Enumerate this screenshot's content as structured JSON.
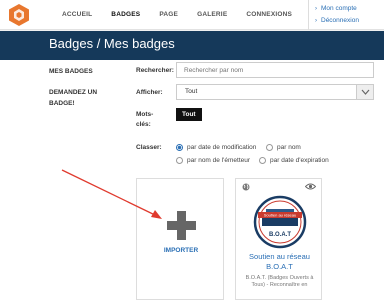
{
  "nav": {
    "items": [
      "ACCUEIL",
      "BADGES",
      "PAGE",
      "GALERIE",
      "CONNEXIONS"
    ],
    "active_index": 1
  },
  "user_menu": {
    "profile": "Mon compte",
    "logout": "Déconnexion"
  },
  "header": {
    "title": "Badges / Mes badges"
  },
  "sidebar": {
    "items": [
      "MES BADGES",
      "DEMANDEZ UN BADGE!"
    ]
  },
  "filters": {
    "search_label": "Rechercher:",
    "search_placeholder": "Rechercher par nom",
    "show_label": "Afficher:",
    "show_value": "Tout",
    "keywords_label": "Mots-clés:",
    "keyword_tag": "Tout",
    "sort_label": "Classer:",
    "sort_options": [
      "par date de modification",
      "par nom",
      "par nom de l'émetteur",
      "par date d'expiration"
    ],
    "sort_selected": 0
  },
  "cards": {
    "import_label": "IMPORTER",
    "badge": {
      "title": "Soutien au réseau B.O.A.T",
      "description": "B.O.A.T. (Badges Ouverts à Tous) - Reconnaître en",
      "image_banner": "Soutien au réseau",
      "image_text": "B.O.A.T"
    }
  },
  "colors": {
    "accent": "#2a6fb5",
    "header": "#15395a",
    "annotation_arrow": "#e03a2e",
    "logo": "#e8772e"
  }
}
